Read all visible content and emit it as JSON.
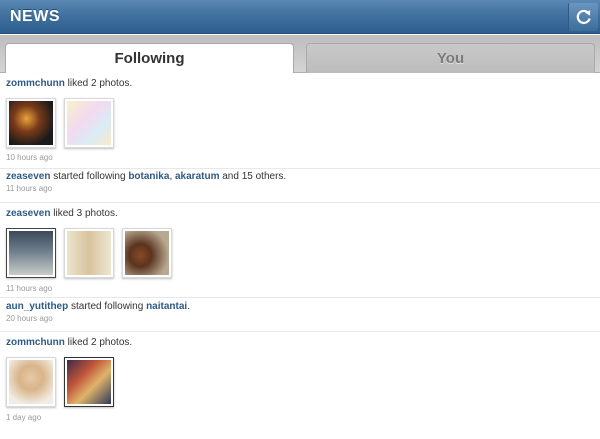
{
  "header": {
    "title": "NEWS",
    "refresh_icon": "refresh-icon"
  },
  "tabs": [
    {
      "label": "Following",
      "active": true
    },
    {
      "label": "You",
      "active": false
    }
  ],
  "feed": [
    {
      "user": "zommchunn",
      "action": " liked 2 photos.",
      "time": "10 hours ago",
      "thumbs": [
        "photo-honeymoon",
        "photo-cartoon-couple"
      ]
    },
    {
      "user": "zeaseven",
      "action": " started following ",
      "targets": [
        "botanika",
        "akaratum"
      ],
      "sep": ", ",
      "tail": " and 15 others.",
      "time": "11 hours ago"
    },
    {
      "user": "zeaseven",
      "action": " liked 3 photos.",
      "time": "11 hours ago",
      "thumbs": [
        "photo-girl-standing",
        "photo-girl-mirror",
        "photo-bottle"
      ]
    },
    {
      "user": "aun_yutithep",
      "action": " started following ",
      "targets": [
        "naitantai"
      ],
      "tail": ".",
      "time": "20 hours ago"
    },
    {
      "user": "zommchunn",
      "action": " liked 2 photos.",
      "time": "1 day ago",
      "thumbs": [
        "photo-baby",
        "photo-collage"
      ]
    }
  ],
  "colors": {
    "header": "#3f6f9d",
    "username": "#2e5a84"
  }
}
